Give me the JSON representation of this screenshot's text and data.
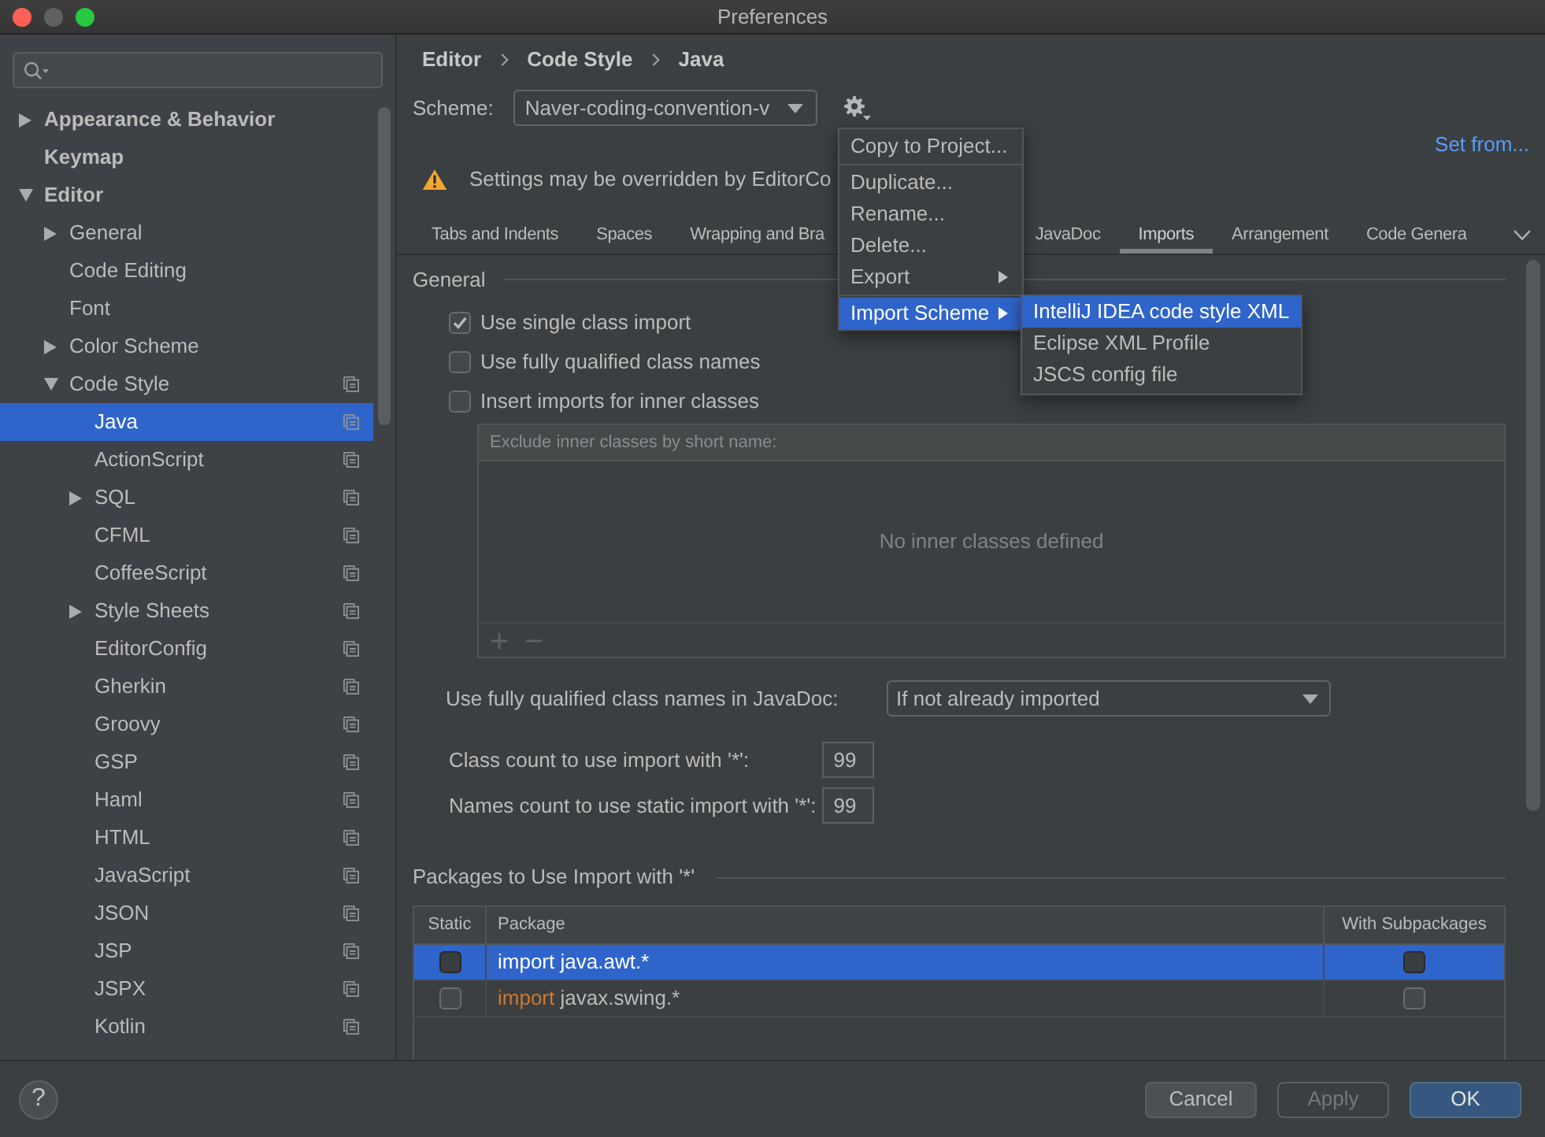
{
  "window": {
    "title": "Preferences"
  },
  "sidebar": {
    "tree": [
      {
        "label": "Appearance & Behavior",
        "expanded": false,
        "selected": false
      },
      {
        "label": "Keymap",
        "selected": false
      },
      {
        "label": "Editor",
        "expanded": true,
        "selected": false,
        "children": [
          {
            "label": "General",
            "expanded": false,
            "selected": false
          },
          {
            "label": "Code Editing",
            "selected": false
          },
          {
            "label": "Font",
            "selected": false
          },
          {
            "label": "Color Scheme",
            "expanded": false,
            "selected": false
          },
          {
            "label": "Code Style",
            "expanded": true,
            "selected": false,
            "scheme_specific": true,
            "children": [
              {
                "label": "Java",
                "selected": true,
                "scheme_specific": true
              },
              {
                "label": "ActionScript",
                "selected": false,
                "scheme_specific": true
              },
              {
                "label": "SQL",
                "expanded": false,
                "selected": false,
                "scheme_specific": true
              },
              {
                "label": "CFML",
                "selected": false,
                "scheme_specific": true
              },
              {
                "label": "CoffeeScript",
                "selected": false,
                "scheme_specific": true
              },
              {
                "label": "Style Sheets",
                "expanded": false,
                "selected": false,
                "scheme_specific": true
              },
              {
                "label": "EditorConfig",
                "selected": false,
                "scheme_specific": true
              },
              {
                "label": "Gherkin",
                "selected": false,
                "scheme_specific": true
              },
              {
                "label": "Groovy",
                "selected": false,
                "scheme_specific": true
              },
              {
                "label": "GSP",
                "selected": false,
                "scheme_specific": true
              },
              {
                "label": "Haml",
                "selected": false,
                "scheme_specific": true
              },
              {
                "label": "HTML",
                "selected": false,
                "scheme_specific": true
              },
              {
                "label": "JavaScript",
                "selected": false,
                "scheme_specific": true
              },
              {
                "label": "JSON",
                "selected": false,
                "scheme_specific": true
              },
              {
                "label": "JSP",
                "selected": false,
                "scheme_specific": true
              },
              {
                "label": "JSPX",
                "selected": false,
                "scheme_specific": true
              },
              {
                "label": "Kotlin",
                "selected": false,
                "scheme_specific": true
              }
            ]
          }
        ]
      }
    ]
  },
  "breadcrumb": [
    "Editor",
    "Code Style",
    "Java"
  ],
  "scheme": {
    "label": "Scheme:",
    "value": "Naver-coding-convention-v"
  },
  "set_from_link": "Set from...",
  "warning": "Settings may be overridden by EditorCo",
  "tabs": [
    {
      "label": "Tabs and Indents",
      "selected": false
    },
    {
      "label": "Spaces",
      "selected": false
    },
    {
      "label": "Wrapping and Bra",
      "selected": false
    },
    {
      "label": "JavaDoc",
      "selected": false
    },
    {
      "label": "Imports",
      "selected": true
    },
    {
      "label": "Arrangement",
      "selected": false
    },
    {
      "label": "Code Genera",
      "selected": false
    }
  ],
  "general": {
    "title": "General",
    "options": [
      {
        "label": "Use single class import",
        "checked": true
      },
      {
        "label": "Use fully qualified class names",
        "checked": false
      },
      {
        "label": "Insert imports for inner classes",
        "checked": false
      }
    ],
    "exclude_list": {
      "header": "Exclude inner classes by short name:",
      "empty_text": "No inner classes defined"
    }
  },
  "javadoc": {
    "label": "Use fully qualified class names in JavaDoc:",
    "value": "If not already imported"
  },
  "counts": [
    {
      "label": "Class count to use import with '*':",
      "value": "99"
    },
    {
      "label": "Names count to use static import with '*':",
      "value": "99"
    }
  ],
  "packages": {
    "title": "Packages to Use Import with '*'",
    "columns": [
      "Static",
      "Package",
      "With Subpackages"
    ],
    "rows": [
      {
        "static": false,
        "keyword": "import",
        "package": "java.awt.*",
        "with_subpackages": false,
        "selected": true
      },
      {
        "static": false,
        "keyword": "import",
        "package": "javax.swing.*",
        "with_subpackages": false,
        "selected": false
      }
    ]
  },
  "help_button": "?",
  "buttons": [
    {
      "label": "Cancel",
      "kind": "normal",
      "disabled": false
    },
    {
      "label": "Apply",
      "kind": "normal",
      "disabled": true
    },
    {
      "label": "OK",
      "kind": "primary",
      "disabled": false
    }
  ],
  "scheme_menu": {
    "items": [
      {
        "kind": "item",
        "label": "Copy to Project...",
        "submenu": false,
        "selected": false
      },
      {
        "kind": "separator"
      },
      {
        "kind": "item",
        "label": "Duplicate...",
        "submenu": false,
        "selected": false
      },
      {
        "kind": "item",
        "label": "Rename...",
        "submenu": false,
        "selected": false
      },
      {
        "kind": "item",
        "label": "Delete...",
        "submenu": false,
        "selected": false
      },
      {
        "kind": "item",
        "label": "Export",
        "submenu": true,
        "selected": false
      },
      {
        "kind": "separator"
      },
      {
        "kind": "item",
        "label": "Import Scheme",
        "submenu": true,
        "selected": true
      }
    ]
  },
  "import_submenu": {
    "items": [
      {
        "label": "IntelliJ IDEA code style XML",
        "selected": true
      },
      {
        "label": "Eclipse XML Profile",
        "selected": false
      },
      {
        "label": "JSCS config file",
        "selected": false
      }
    ]
  }
}
